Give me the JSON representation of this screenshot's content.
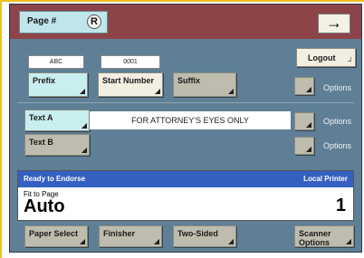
{
  "colors": {
    "topbar": "#8d4448",
    "panel": "#5e7f96",
    "status_header": "#3560c2",
    "tab": "#bfe6ea"
  },
  "header": {
    "tab_label": "Page #",
    "mark": "R",
    "next_arrow": "→"
  },
  "logout_label": "Logout",
  "fields": {
    "prefix_value": "ABC",
    "start_number_value": "0001"
  },
  "buttons": {
    "prefix": "Prefix",
    "start_number": "Start Number",
    "suffix": "Suffix",
    "text_a": "Text A",
    "text_b": "Text B",
    "paper_select": "Paper Select",
    "finisher": "Finisher",
    "two_sided": "Two-Sided",
    "scanner_options": "Scanner\nOptions"
  },
  "options_label": "Options",
  "endorse_text": "FOR ATTORNEY'S EYES ONLY",
  "status": {
    "left": "Ready to Endorse",
    "right": "Local Printer",
    "fit_label": "Fit to Page",
    "mode": "Auto",
    "count": "1"
  }
}
